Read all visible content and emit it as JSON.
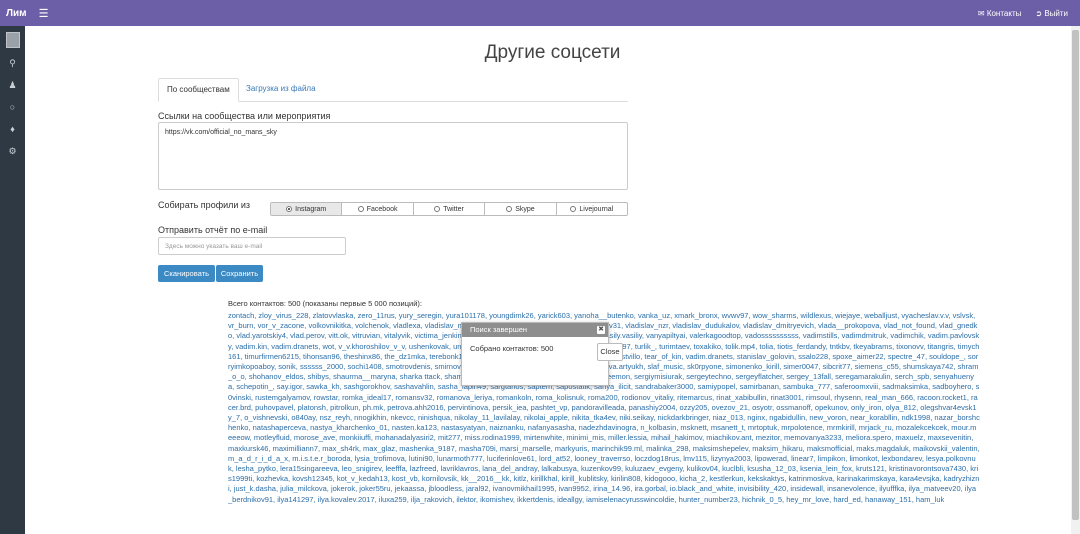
{
  "header": {
    "brand": "Лим",
    "menu_icon": "hamburger-icon",
    "contacts_label": "Контакты",
    "logout_label": "Выйти"
  },
  "sidebar": {
    "icons": [
      "search-icon",
      "users-icon",
      "chat-icon",
      "pin-icon",
      "gears-icon"
    ]
  },
  "page": {
    "title": "Другие соцсети"
  },
  "tabs": {
    "by_community": "По сообществам",
    "from_file": "Загрузка из файла"
  },
  "form": {
    "links_label": "Ссылки на сообщества или мероприятия",
    "links_value": "https://vk.com/official_no_mans_sky",
    "collect_label": "Собирать профили из",
    "sources": [
      "Instagram",
      "Facebook",
      "Twitter",
      "Skype",
      "Livejournal"
    ],
    "selected_source": "Instagram",
    "email_label": "Отправить отчёт по e-mail",
    "email_placeholder": "Здесь можно указать ваш e-mail",
    "scan_button": "Сканировать",
    "save_button": "Сохранить"
  },
  "results": {
    "total_text": "Всего контактов: 500 (показаны первые 5 000 позиций):",
    "contacts_text": "zontach, zloy_virus_228, zlatovvlaska, zero_11rus, yury_seregin, yura101178, youngdimk26, yarick603, yanoha__butenko, vanka_uz, xmark_bronx, wvwv97, wow_sharms, wildlexus, wiejaye, weballjust, vyacheslav.v.v, vslvsk, vr_burn, vor_v_zacone, volkovnikitka, volchenok, vladlexa, vladislav_mih, vladislavsak, vivom, vlz_forex, vladislavvv31, vladislav_nzr, vladislav_dudukalov, vladislav_dmitryevich, vlada__prokopova, vlad_not_found, vlad_gnedko, vlad.yarotskiy4, vlad.perov, vitt.ok, vitruvian, vitalyvik, victima_jenkins, vdvoretcky_19, vattghern_gwynb1eidd, vasily.vasiliy, vanyapiltyai, valerkagoodtop, vadossssssssss, vadimstills, vadimdmitruk, vadimchik, vadim.pavlovsky, vadim.kin, vadim.dranets, wot, v_v.khoroshilov_v_v, ushenkovak, und3adman, ufc.the_fighter194, tw1godler, turson897, turlik_, turimtaev, toxakiko, tolik.mp4, tolia, tiotis_ferdandy, tntkbv, tkeyabrams, tixonovv, titangris, timych161, timurfirmen6215, tihonsan96, theshinx86, the_dz1mka, terebonk1337, temno.ezh, tenhik456, tefirof, teff_rus, teekstvillo, tear_of_kin, vadim.dranets, stanislav_golovin, ssalo228, spoxe_aimer22, spectre_47, souldope_, sorryimkopoaboy, sonik, ssssss_2000, sochi1408, smotrovdenis, smirnov999, slishkomizi, slgmtt, slavianshigonov, slava.artyukh, slaf_music, sk0rpyone, simonenko_kirill, simer0047, sibcrit77, siemens_c55, shumskaya742, shram_o_o, shohanov_eldos, shibys, shaurma__maryna, sharka ttack, shamshikk, shamil_unisov, sh.zhanibekov, sergoleemon, sergiymisiurak, sergeytechno, sergeyflatcher, sergey_13fall, seregamarakulin, serch_spb, senyahuenya, schepotin_, say.igor, sawka_kh, sashgorokhov, sashavahlin, sasha_lapin49, sargtanos, saptem, sapostatik, sanya_ilicit, sandrabaker3000, samiypopel, samirbanan, sambuka_777, saferoomxviii, sadmaksimka, sadboyhero, s0vinski, rustemgalyamov, rowstar, romka_ideal17, romansv32, romanova_leriya, romankoln, roma_kolisnuk, roma200, rodionov_vitaliy, ritemarcus, rinat_xabibullin, rinat3001, rimsoul, rhysenn, real_man_666, racoon.rocket1, racer.brd, puhovpavel, platonsh, pitrolkun, ph.mk, petrova.ahh2016, pervintinova, persik_iea, pashtet_vp, pandoravilleada, panashiy2004, ozzy205, ovezov_21, osyotr, ossmanoff, opekunov, only_iron, olya_812, olegshvar4evsk1y_7, o_vishnevski, o840ay, nsz_reyh, nnogikhin, nkevcc, ninishqua, nikolay_11_lavilalay, nikolai_apple, nikita_tka4ev, niki.seikay, nickdarkbringer, niaz_013, nginx, ngabidullin, new_voron, near_korabllin, ndk1998, nazar_borshchenko, natashaperceva, nastya_kharchenko_01, nasten.ka123, nastasyatyan, naiznanku, nafanyasasha, nadezhdavinogra, n_kolbasin, msknett, msanett_t, mrtoptuk, mrpolotence, mrmkirill, mrjack_ru, mozalekcekcek, mour.meeeow, motleyfluid, morose_ave, monkiiuffi, mohanadalyasiri2, mit277, miss.rodina1999, mirtenwhite, minimi_mis, miller.lessia, mihail_hakimov, miachikov.ant, mezitor, memovanya3233, meliora.spero, maxuelz, maxsevenitin, maxkursk46, maximilliann7, max_sh4rk, max_glaz, mashenka_9187, masha709i, marsi_marselle, markyuris, marinchik99.ml, malinka_298, maksimshepelev, maksim_hikaru, maksmofficial, maks.magdaluk, maikovskii_valentin, m_a_d_r_i_d_a_x, m.i.s.t.e.r_boroda, lysia_trofimova, lutini90, lunarmoth777, luciferinlove61, lord_at52, looney_traverrso, loczdog18rus, lmv115, lizynya2003, lipowerad, linear7, limpikon, limonkot, lexbondarev, lesya.polkovnuk, lesha_pytko, lera15singareeva, leo_snigirev, leefffa, lazfreed, lavriklavros, lana_del_andray, lalkabusya, kuzenkov99, kuluzaev_evgeny, kulikov04, kuclbli, ksusha_12_03, ksenia_lein_fox, kruts121, kristinavorontsova7430, kris1999ti, kozhevka, kovsh12345, kot_v_kedah13, kost_vb, kornilovsik, kk__2016__kk, kitlz, kirillkhal, kirill_kublitsky, kirilin808, kidogooo, kicha_2, kestlerkun, kekskaktys, katrinmoskva, karinakarimskaya, kara4evsjka, kadryzhizni, just_k.dasha, julia_milckova, jokerok, joker55ru, jekaassa, jbloodless, jaral92, ivanovmikhail1995, ivan9952, irina_14.96, ira.gorbal, io.black_and_white, invisibility_420, insidewall, insanevolence, ilyufffka, ilya_matveev20, ilya_berdnikov91, ilya141297, ilya.kovalev.2017, iluxa259, ilja_rakovich, ilektor, ikomishev, ikkertdenis, ideallgy, iamiselenacyrusswincoldie, hunter_number23, hichnik_0_5, hey_mr_love, hard_ed, hanaway_151, ham_luk"
  },
  "dialog": {
    "title": "Поиск завершен",
    "message": "Собрано контактов: 500",
    "close_label": "Close"
  }
}
